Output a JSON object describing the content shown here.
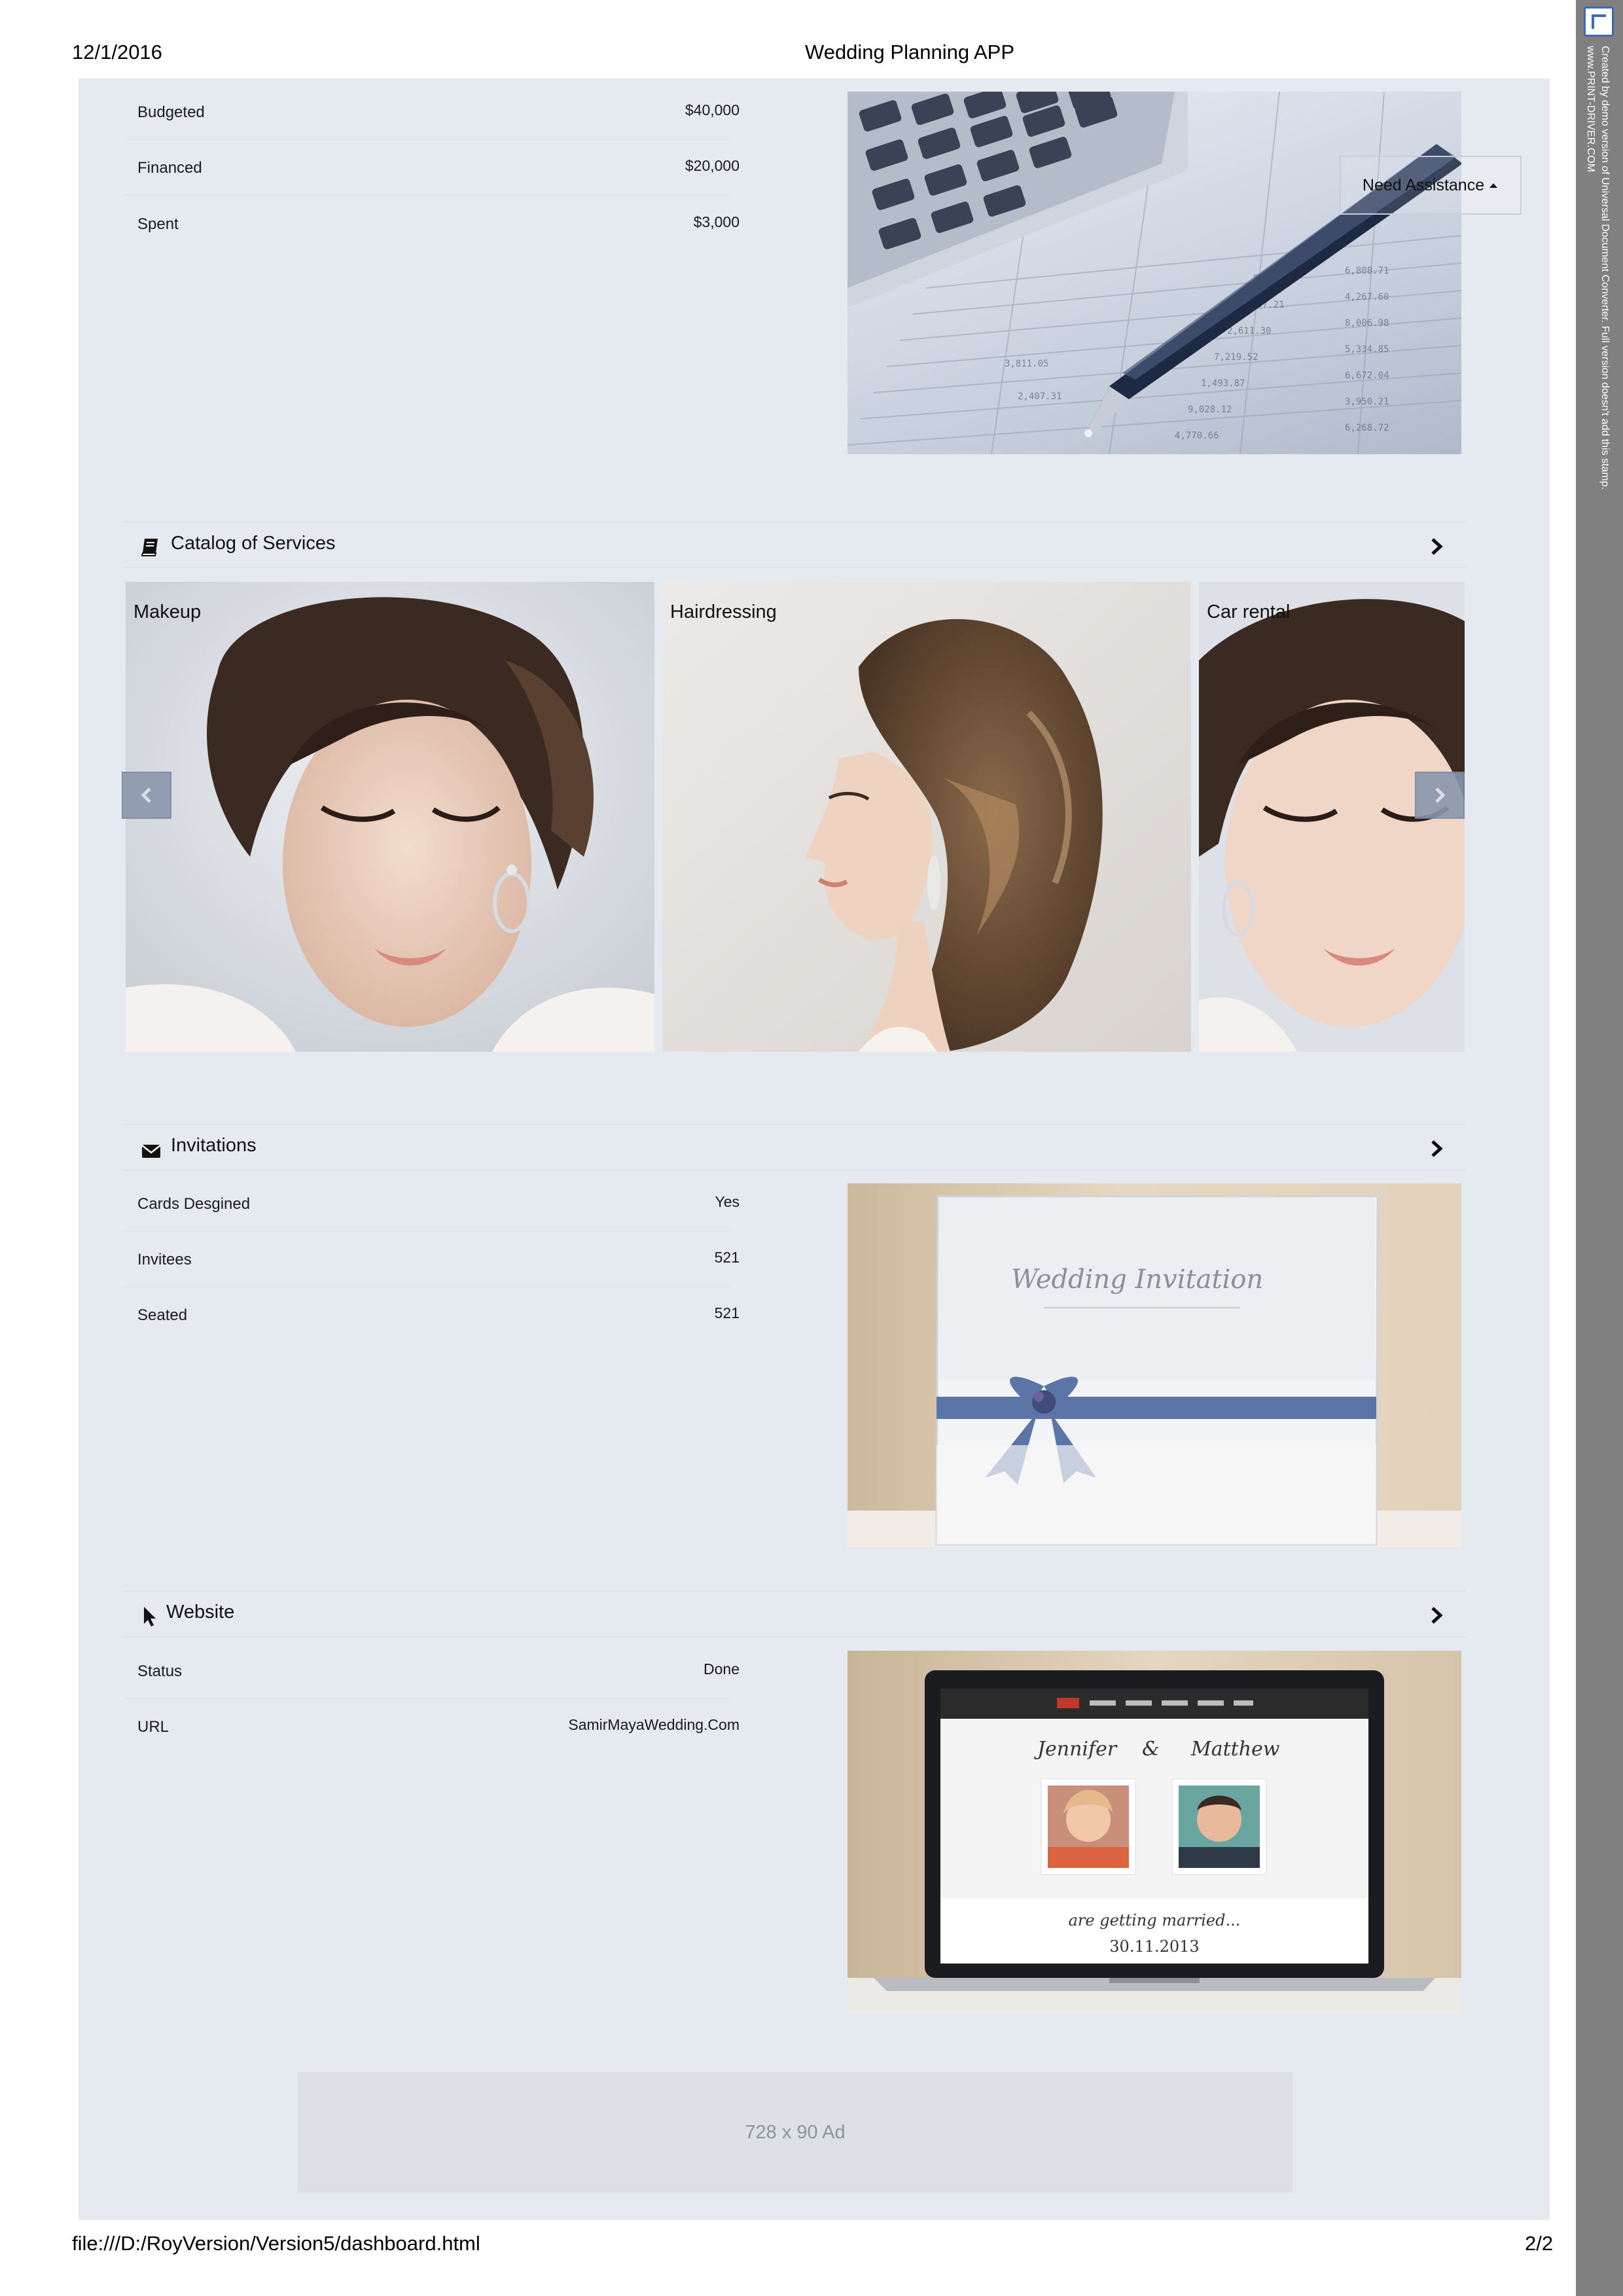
{
  "print_header": {
    "date": "12/1/2016",
    "title": "Wedding Planning APP"
  },
  "print_footer": {
    "url": "file:///D:/RoyVersion/Version5/dashboard.html",
    "page": "2/2"
  },
  "stamp": {
    "line1": "Created by demo version of Universal Document Converter. Full version doesn't add this stamp.",
    "line2": "www.PRINT-DRIVER.COM"
  },
  "budget": {
    "rows": [
      {
        "label": "Budgeted",
        "value": "$40,000"
      },
      {
        "label": "Financed",
        "value": "$20,000"
      },
      {
        "label": "Spent",
        "value": "$3,000"
      }
    ],
    "need_assistance_label": "Need Assistance"
  },
  "catalog": {
    "title": "Catalog of Services",
    "icon": "book-icon",
    "services": [
      {
        "label": "Makeup"
      },
      {
        "label": "Hairdressing"
      },
      {
        "label": "Car rental"
      }
    ]
  },
  "invitations": {
    "title": "Invitations",
    "icon": "envelope-icon",
    "rows": [
      {
        "label": "Cards Desgined",
        "value": "Yes"
      },
      {
        "label": "Invitees",
        "value": "521"
      },
      {
        "label": "Seated",
        "value": "521"
      }
    ],
    "card_script": "Wedding Invitation"
  },
  "website": {
    "title": "Website",
    "icon": "cursor-icon",
    "rows": [
      {
        "label": "Status",
        "value": "Done"
      },
      {
        "label": "URL",
        "value": "SamirMayaWedding.Com"
      }
    ],
    "screen_names_left": "Jennifer",
    "screen_names_amp": "&",
    "screen_names_right": "Matthew",
    "screen_tagline": "are getting married...",
    "screen_date": "30.11.2013"
  },
  "ad": {
    "label": "728 x 90 Ad"
  },
  "colors": {
    "page_background": "#e5eaf1",
    "stamp_bar": "#808080",
    "carousel_button": "#8b97ad",
    "ad_box": "#dde0e5"
  }
}
